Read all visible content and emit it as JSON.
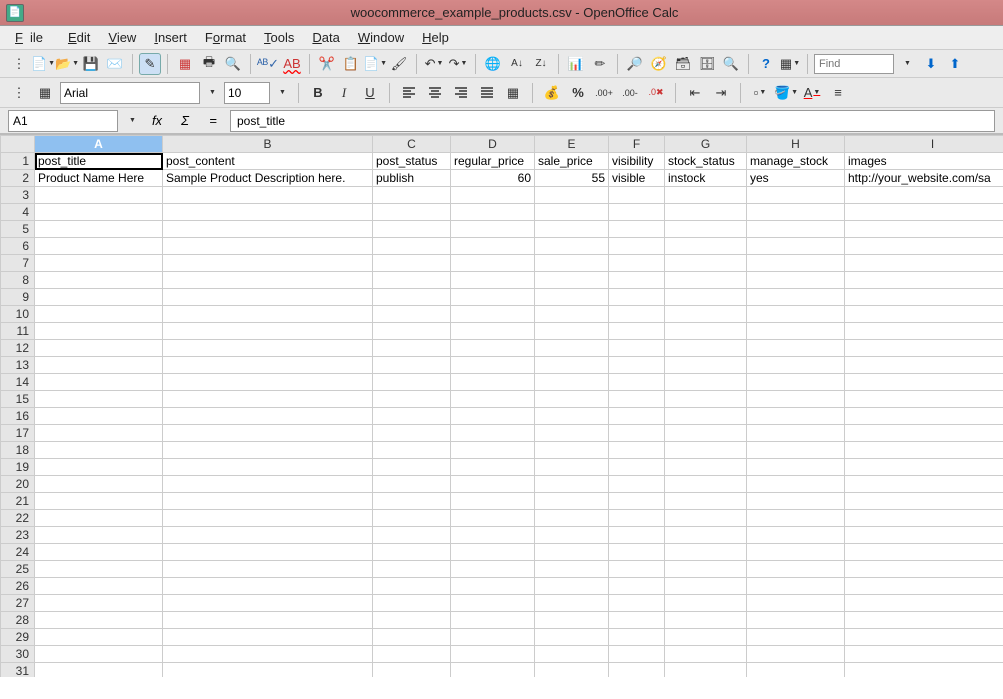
{
  "title": "woocommerce_example_products.csv - OpenOffice Calc",
  "menus": {
    "file": "File",
    "edit": "Edit",
    "view": "View",
    "insert": "Insert",
    "format": "Format",
    "tools": "Tools",
    "data": "Data",
    "window": "Window",
    "help": "Help"
  },
  "font": {
    "name": "Arial",
    "size": "10"
  },
  "find_placeholder": "Find",
  "cellref": "A1",
  "formula_value": "post_title",
  "sigma": "Σ",
  "eq": "=",
  "fx": "fx",
  "columns": [
    "A",
    "B",
    "C",
    "D",
    "E",
    "F",
    "G",
    "H",
    "I"
  ],
  "rows": 31,
  "data_rows": [
    {
      "A": "post_title",
      "B": "post_content",
      "C": "post_status",
      "D": "regular_price",
      "E": "sale_price",
      "F": "visibility",
      "G": "stock_status",
      "H": "manage_stock",
      "I": "images"
    },
    {
      "A": "Product Name Here",
      "B": "Sample Product Description here.",
      "C": "publish",
      "D": "60",
      "E": "55",
      "F": "visible",
      "G": "instock",
      "H": "yes",
      "I": "http://your_website.com/sa"
    }
  ],
  "colwidths": {
    "A": 128,
    "B": 210,
    "C": 78,
    "D": 84,
    "E": 74,
    "F": 56,
    "G": 82,
    "H": 98,
    "I": 176
  },
  "numcols": [
    "D",
    "E"
  ],
  "active": "A1"
}
